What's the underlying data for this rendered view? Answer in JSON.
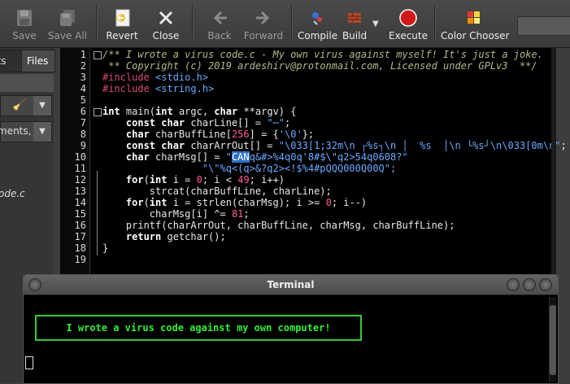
{
  "toolbar": {
    "save": "Save",
    "save_all": "Save All",
    "revert": "Revert",
    "close": "Close",
    "back": "Back",
    "forward": "Forward",
    "compile": "Compile",
    "build": "Build",
    "execute": "Execute",
    "color_chooser": "Color Chooser"
  },
  "sidebar": {
    "tabs": [
      "nts",
      "Files"
    ],
    "combo2_text": "ments,",
    "file_item": "ode.c"
  },
  "editor": {
    "line_numbers": [
      "1",
      "2",
      "3",
      "4",
      "5",
      "6",
      "7",
      "8",
      "9",
      "10",
      "11",
      "12",
      "13",
      "14",
      "15",
      "16",
      "17",
      "18",
      "19"
    ],
    "lines": {
      "l1": "/** I wrote a virus code.c - My own virus against myself! It's just a joke.",
      "l2": " ** Copyright (c) 2019 ardeshirv@protonmail.com, Licensed under GPLv3  **/",
      "l3_pp": "#include",
      "l3_str": " <stdio.h>",
      "l4_pp": "#include",
      "l4_str": " <string.h>",
      "l6a": "int",
      "l6b": " main(",
      "l6c": "int",
      "l6d": " argc, ",
      "l6e": "char",
      "l6f": " **argv) {",
      "l7a": "    const char",
      "l7b": " charLine[] = ",
      "l7c": "\"─\"",
      "l7d": ";",
      "l8a": "    char",
      "l8b": " charBuffLine[",
      "l8c": "256",
      "l8d": "] = {",
      "l8e": "'\\0'",
      "l8f": "};",
      "l9a": "    const char",
      "l9b": " charArrOut[] = ",
      "l9c": "\"\\033[1;32m\\n ┌%s┐\\n │  %s  │\\n └%s┘\\n\\033[0m\\n\"",
      "l9d": ";",
      "l10a": "    char",
      "l10b": " charMsg[] = ",
      "l10c": "\"",
      "l10sel": "CAN",
      "l10d": "q&#>%4q0q'8#$\\\"q2>54q0608?\"",
      "l11": "                 \"\\\"%q<(q>&?q2><!$%4#pQQQ000Q00Q\";",
      "l12a": "    for",
      "l12b": "(",
      "l12c": "int",
      "l12d": " i = ",
      "l12e": "0",
      "l12f": "; i < ",
      "l12g": "49",
      "l12h": "; i++)",
      "l13": "        strcat(charBuffLine, charLine);",
      "l14a": "    for",
      "l14b": "(",
      "l14c": "int",
      "l14d": " i = strlen(charMsg); i >= ",
      "l14e": "0",
      "l14f": "; i--)",
      "l15a": "        charMsg[i] ^= ",
      "l15b": "81",
      "l15c": ";",
      "l16": "    printf(charArrOut, charBuffLine, charMsg, charBuffLine);",
      "l17a": "    return",
      "l17b": " getchar();",
      "l18": "}"
    }
  },
  "terminal": {
    "title": "Terminal",
    "message": "I wrote a virus code against my own computer!"
  }
}
